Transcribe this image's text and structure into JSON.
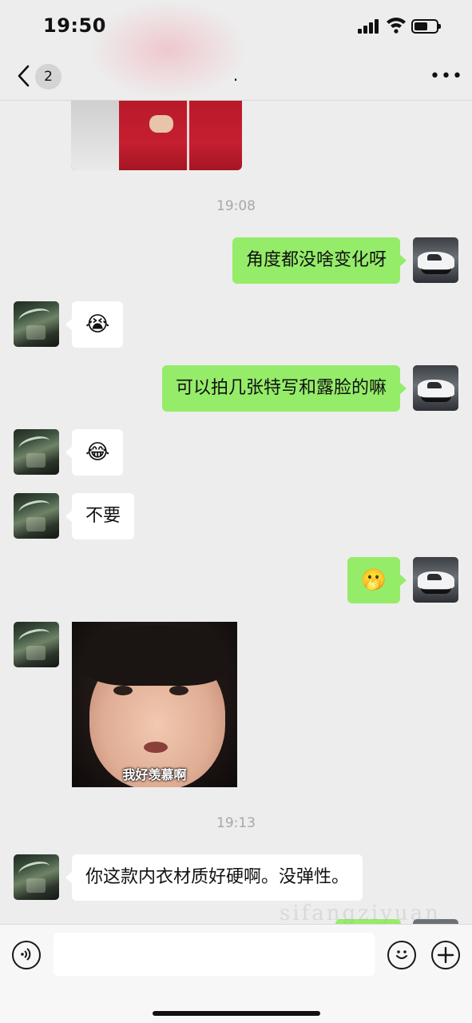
{
  "status_bar": {
    "time": "19:50"
  },
  "nav": {
    "unread_count": "2",
    "title": "."
  },
  "chat": {
    "timestamps": [
      "19:08",
      "19:13"
    ],
    "messages": [
      {
        "side": "right",
        "text": "角度都没啥变化呀"
      },
      {
        "side": "left",
        "emoji": "😭"
      },
      {
        "side": "right",
        "text": "可以拍几张特写和露脸的嘛"
      },
      {
        "side": "left",
        "emoji": "😂"
      },
      {
        "side": "left",
        "text": "不要"
      },
      {
        "side": "right",
        "emoji": "🫢"
      },
      {
        "side": "left",
        "sticker_caption": "我好羡慕啊"
      },
      {
        "side": "left",
        "text": "你这款内衣材质好硬啊。没弹性。"
      }
    ]
  },
  "watermark": "sifangziyuan",
  "colors": {
    "background": "#ededed",
    "sent_bubble": "#95ec69",
    "received_bubble": "#ffffff"
  }
}
